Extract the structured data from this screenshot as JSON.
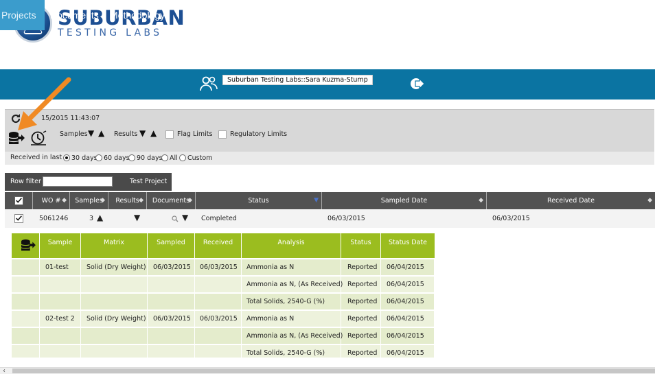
{
  "logo": {
    "name": "SUBURBAN",
    "sub": "TESTING LABS"
  },
  "nav": {
    "items": [
      {
        "label": "Projects",
        "active": true
      },
      {
        "label": "Documents",
        "active": false
      },
      {
        "label": "Methodology",
        "active": false
      }
    ],
    "user": "Suburban Testing Labs::Sara Kuzma-Stump"
  },
  "toolbar": {
    "timestamp": "15/2015 11:43:07",
    "samples_label": "Samples",
    "results_label": "Results",
    "flag_limits_label": "Flag Limits",
    "regulatory_limits_label": "Regulatory Limits",
    "received_label": "Received in last",
    "ranges": [
      {
        "label": "30 days",
        "selected": true
      },
      {
        "label": "60 days",
        "selected": false
      },
      {
        "label": "90 days",
        "selected": false
      },
      {
        "label": "All",
        "selected": false
      },
      {
        "label": "Custom",
        "selected": false
      }
    ]
  },
  "filter": {
    "label": "Row filter",
    "value": "",
    "project_label": "Test Project"
  },
  "table": {
    "columns": [
      "WO #",
      "Samples",
      "Results",
      "Documents",
      "Status",
      "Sampled Date",
      "Received Date"
    ],
    "rows": [
      {
        "wo": "5061246",
        "samples": "3",
        "status": "Completed",
        "sampled_date": "06/03/2015",
        "received_date": "06/03/2015"
      }
    ]
  },
  "subtable": {
    "columns": [
      "Sample",
      "Matrix",
      "Sampled",
      "Received",
      "Analysis",
      "Status",
      "Status Date"
    ],
    "rows": [
      {
        "sample": "01-test",
        "matrix": "Solid (Dry Weight)",
        "sampled": "06/03/2015",
        "received": "06/03/2015",
        "analysis": "Ammonia as N",
        "status": "Reported",
        "status_date": "06/04/2015"
      },
      {
        "sample": "",
        "matrix": "",
        "sampled": "",
        "received": "",
        "analysis": "Ammonia as N, (As Received)",
        "status": "Reported",
        "status_date": "06/04/2015"
      },
      {
        "sample": "",
        "matrix": "",
        "sampled": "",
        "received": "",
        "analysis": "Total Solids, 2540-G (%)",
        "status": "Reported",
        "status_date": "06/04/2015"
      },
      {
        "sample": "02-test 2",
        "matrix": "Solid (Dry Weight)",
        "sampled": "06/03/2015",
        "received": "06/03/2015",
        "analysis": "Ammonia as N",
        "status": "Reported",
        "status_date": "06/04/2015"
      },
      {
        "sample": "",
        "matrix": "",
        "sampled": "",
        "received": "",
        "analysis": "Ammonia as N, (As Received)",
        "status": "Reported",
        "status_date": "06/04/2015"
      },
      {
        "sample": "",
        "matrix": "",
        "sampled": "",
        "received": "",
        "analysis": "Total Solids, 2540-G (%)",
        "status": "Reported",
        "status_date": "06/04/2015"
      }
    ]
  },
  "colors": {
    "nav": "#0b74a2",
    "nav_active": "#3b9ccc",
    "sub_header": "#9bbd1f",
    "annotation_arrow": "#f08a24"
  },
  "icons": [
    "refresh-icon",
    "export-data-icon",
    "clock-icon",
    "users-icon",
    "logout-icon",
    "magnifier-icon",
    "flask-icon"
  ]
}
